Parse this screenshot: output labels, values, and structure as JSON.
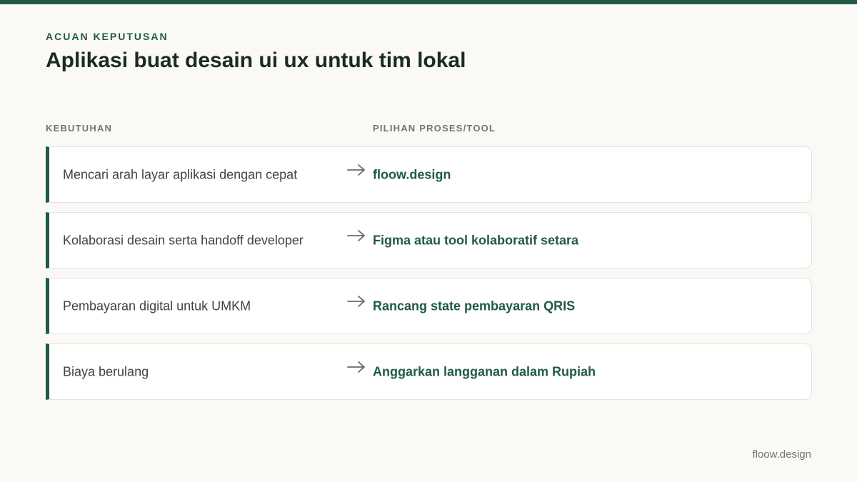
{
  "header": {
    "eyebrow": "ACUAN KEPUTUSAN",
    "title": "Aplikasi buat desain ui ux untuk tim lokal"
  },
  "columns": {
    "need": "KEBUTUHAN",
    "tool": "PILIHAN PROSES/TOOL"
  },
  "rows": [
    {
      "need": "Mencari arah layar aplikasi dengan cepat",
      "arrow_icon": "arrow-right-icon",
      "tool": "floow.design"
    },
    {
      "need": "Kolaborasi desain serta handoff developer",
      "arrow_icon": "arrow-right-icon",
      "tool": "Figma atau tool kolaboratif setara"
    },
    {
      "need": "Pembayaran digital untuk UMKM",
      "arrow_icon": "arrow-right-icon",
      "tool": "Rancang state pembayaran QRIS"
    },
    {
      "need": "Biaya berulang",
      "arrow_icon": "arrow-right-icon",
      "tool": "Anggarkan langganan dalam Rupiah"
    }
  ],
  "footer": {
    "brand": "floow.design"
  },
  "colors": {
    "accent": "#1f5a45",
    "background": "#faf9f5",
    "muted_text": "#6f766f",
    "card_border": "#e2e3de"
  }
}
